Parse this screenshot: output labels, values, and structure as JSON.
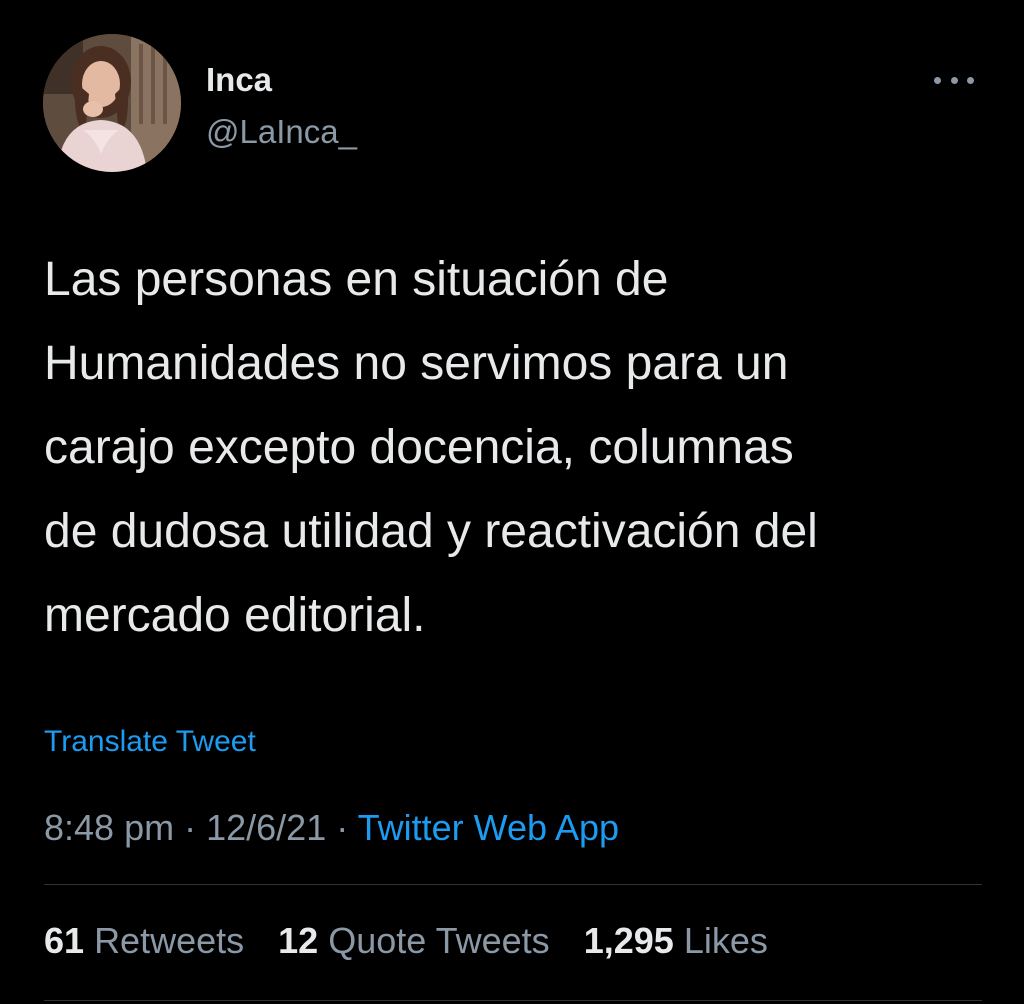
{
  "author": {
    "display_name": "Inca",
    "handle": "@LaInca_"
  },
  "tweet": {
    "lines": [
      "Las personas en situación de",
      "Humanidades no servimos para un",
      "carajo excepto docencia, columnas",
      "de dudosa utilidad y reactivación del",
      "mercado editorial."
    ],
    "translate_label": "Translate Tweet",
    "time": "8:48 pm",
    "separator": "·",
    "date": "12/6/21",
    "source": "Twitter Web App"
  },
  "stats": {
    "retweets_count": "61",
    "retweets_label": "Retweets",
    "quotes_count": "12",
    "quotes_label": "Quote Tweets",
    "likes_count": "1,295",
    "likes_label": "Likes"
  },
  "icons": {
    "more": "more-horizontal-icon"
  },
  "colors": {
    "background": "#000000",
    "accent": "#1d9bf0",
    "secondary_text": "#8b98a5",
    "primary_text": "#e7e9ea",
    "divider": "#2f3336"
  }
}
